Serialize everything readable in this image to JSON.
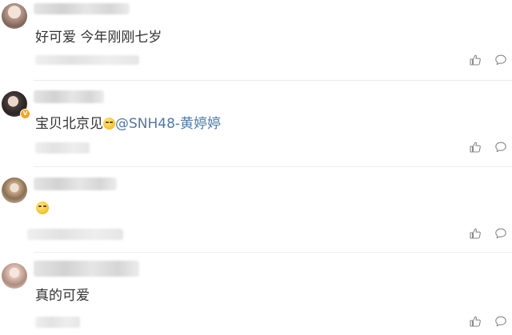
{
  "comments": [
    {
      "text": "好可爱 今年刚刚七岁",
      "parts": [],
      "emoji_only": false,
      "verified": false
    },
    {
      "text": "",
      "parts": [
        {
          "text": "宝贝北京见",
          "type": "plain"
        },
        {
          "text": "",
          "type": "emoji",
          "icon": "sly-smile-emoji"
        },
        {
          "text": "@SNH48-黄婷婷",
          "type": "mention"
        }
      ],
      "emoji_only": false,
      "verified": true
    },
    {
      "text": "",
      "parts": [],
      "emoji_only": true,
      "emoji_icon": "sly-smile-emoji",
      "verified": false
    },
    {
      "text": "真的可爱",
      "parts": [],
      "emoji_only": false,
      "verified": false
    }
  ],
  "icons": {
    "like": "thumbs-up-icon",
    "reply": "comment-bubble-icon",
    "verified": "verified-badge-icon"
  },
  "colors": {
    "text": "#333333",
    "mention": "#4f79a8",
    "icon": "#8a8a8a",
    "divider": "#ececec",
    "verified_badge": "#f5a623"
  }
}
